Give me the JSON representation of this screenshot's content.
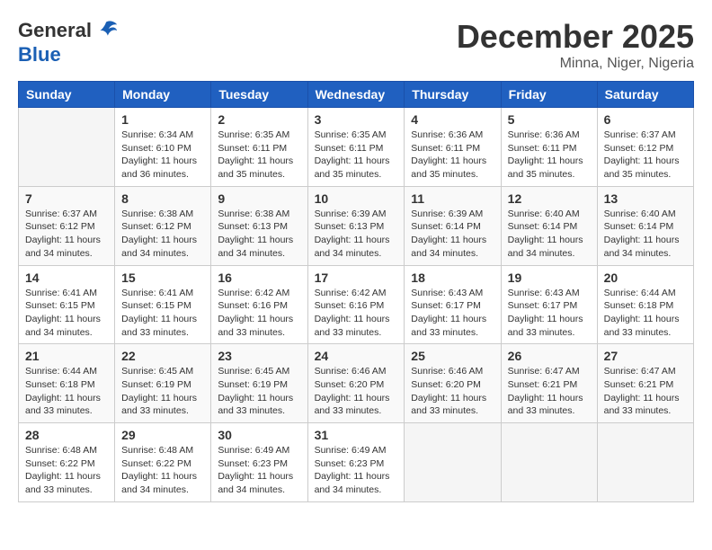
{
  "header": {
    "logo_line1": "General",
    "logo_line2": "Blue",
    "month": "December 2025",
    "location": "Minna, Niger, Nigeria"
  },
  "days_of_week": [
    "Sunday",
    "Monday",
    "Tuesday",
    "Wednesday",
    "Thursday",
    "Friday",
    "Saturday"
  ],
  "weeks": [
    [
      {
        "day": "",
        "info": ""
      },
      {
        "day": "1",
        "info": "Sunrise: 6:34 AM\nSunset: 6:10 PM\nDaylight: 11 hours and 36 minutes."
      },
      {
        "day": "2",
        "info": "Sunrise: 6:35 AM\nSunset: 6:11 PM\nDaylight: 11 hours and 35 minutes."
      },
      {
        "day": "3",
        "info": "Sunrise: 6:35 AM\nSunset: 6:11 PM\nDaylight: 11 hours and 35 minutes."
      },
      {
        "day": "4",
        "info": "Sunrise: 6:36 AM\nSunset: 6:11 PM\nDaylight: 11 hours and 35 minutes."
      },
      {
        "day": "5",
        "info": "Sunrise: 6:36 AM\nSunset: 6:11 PM\nDaylight: 11 hours and 35 minutes."
      },
      {
        "day": "6",
        "info": "Sunrise: 6:37 AM\nSunset: 6:12 PM\nDaylight: 11 hours and 35 minutes."
      }
    ],
    [
      {
        "day": "7",
        "info": "Sunrise: 6:37 AM\nSunset: 6:12 PM\nDaylight: 11 hours and 34 minutes."
      },
      {
        "day": "8",
        "info": "Sunrise: 6:38 AM\nSunset: 6:12 PM\nDaylight: 11 hours and 34 minutes."
      },
      {
        "day": "9",
        "info": "Sunrise: 6:38 AM\nSunset: 6:13 PM\nDaylight: 11 hours and 34 minutes."
      },
      {
        "day": "10",
        "info": "Sunrise: 6:39 AM\nSunset: 6:13 PM\nDaylight: 11 hours and 34 minutes."
      },
      {
        "day": "11",
        "info": "Sunrise: 6:39 AM\nSunset: 6:14 PM\nDaylight: 11 hours and 34 minutes."
      },
      {
        "day": "12",
        "info": "Sunrise: 6:40 AM\nSunset: 6:14 PM\nDaylight: 11 hours and 34 minutes."
      },
      {
        "day": "13",
        "info": "Sunrise: 6:40 AM\nSunset: 6:14 PM\nDaylight: 11 hours and 34 minutes."
      }
    ],
    [
      {
        "day": "14",
        "info": "Sunrise: 6:41 AM\nSunset: 6:15 PM\nDaylight: 11 hours and 34 minutes."
      },
      {
        "day": "15",
        "info": "Sunrise: 6:41 AM\nSunset: 6:15 PM\nDaylight: 11 hours and 33 minutes."
      },
      {
        "day": "16",
        "info": "Sunrise: 6:42 AM\nSunset: 6:16 PM\nDaylight: 11 hours and 33 minutes."
      },
      {
        "day": "17",
        "info": "Sunrise: 6:42 AM\nSunset: 6:16 PM\nDaylight: 11 hours and 33 minutes."
      },
      {
        "day": "18",
        "info": "Sunrise: 6:43 AM\nSunset: 6:17 PM\nDaylight: 11 hours and 33 minutes."
      },
      {
        "day": "19",
        "info": "Sunrise: 6:43 AM\nSunset: 6:17 PM\nDaylight: 11 hours and 33 minutes."
      },
      {
        "day": "20",
        "info": "Sunrise: 6:44 AM\nSunset: 6:18 PM\nDaylight: 11 hours and 33 minutes."
      }
    ],
    [
      {
        "day": "21",
        "info": "Sunrise: 6:44 AM\nSunset: 6:18 PM\nDaylight: 11 hours and 33 minutes."
      },
      {
        "day": "22",
        "info": "Sunrise: 6:45 AM\nSunset: 6:19 PM\nDaylight: 11 hours and 33 minutes."
      },
      {
        "day": "23",
        "info": "Sunrise: 6:45 AM\nSunset: 6:19 PM\nDaylight: 11 hours and 33 minutes."
      },
      {
        "day": "24",
        "info": "Sunrise: 6:46 AM\nSunset: 6:20 PM\nDaylight: 11 hours and 33 minutes."
      },
      {
        "day": "25",
        "info": "Sunrise: 6:46 AM\nSunset: 6:20 PM\nDaylight: 11 hours and 33 minutes."
      },
      {
        "day": "26",
        "info": "Sunrise: 6:47 AM\nSunset: 6:21 PM\nDaylight: 11 hours and 33 minutes."
      },
      {
        "day": "27",
        "info": "Sunrise: 6:47 AM\nSunset: 6:21 PM\nDaylight: 11 hours and 33 minutes."
      }
    ],
    [
      {
        "day": "28",
        "info": "Sunrise: 6:48 AM\nSunset: 6:22 PM\nDaylight: 11 hours and 33 minutes."
      },
      {
        "day": "29",
        "info": "Sunrise: 6:48 AM\nSunset: 6:22 PM\nDaylight: 11 hours and 34 minutes."
      },
      {
        "day": "30",
        "info": "Sunrise: 6:49 AM\nSunset: 6:23 PM\nDaylight: 11 hours and 34 minutes."
      },
      {
        "day": "31",
        "info": "Sunrise: 6:49 AM\nSunset: 6:23 PM\nDaylight: 11 hours and 34 minutes."
      },
      {
        "day": "",
        "info": ""
      },
      {
        "day": "",
        "info": ""
      },
      {
        "day": "",
        "info": ""
      }
    ]
  ]
}
